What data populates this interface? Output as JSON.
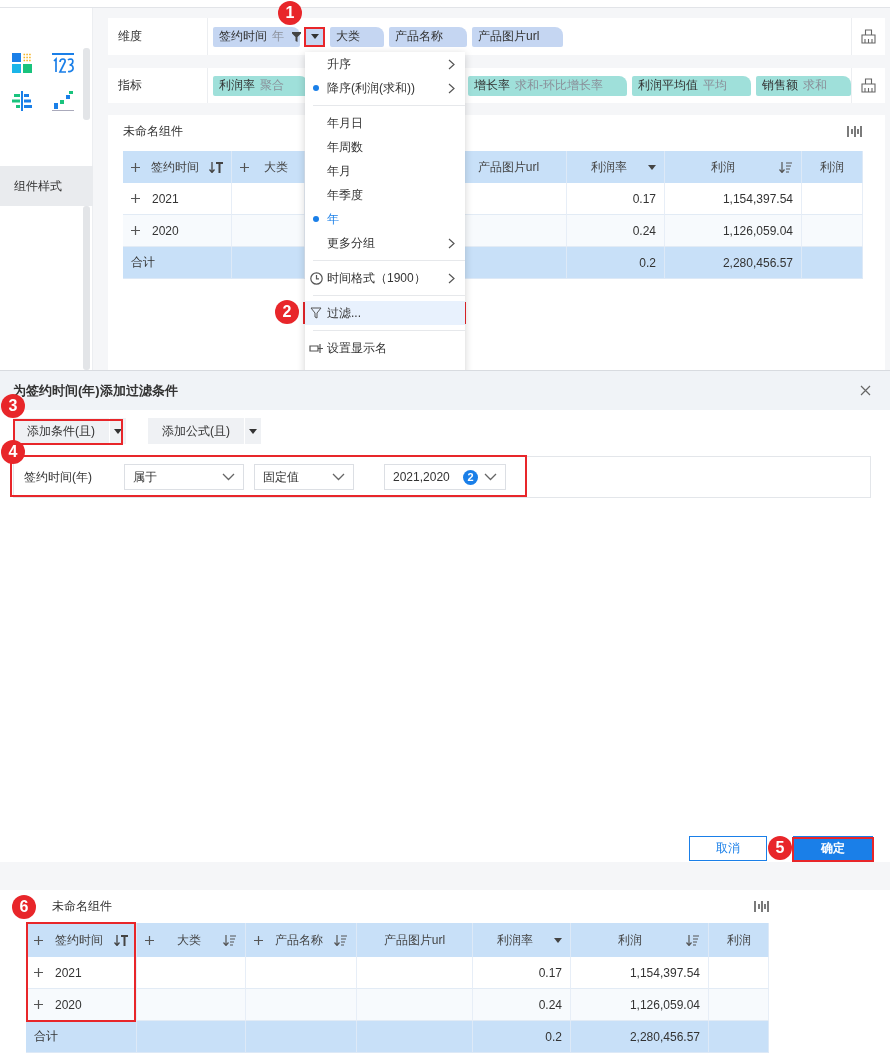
{
  "left_panel": {
    "tab": {
      "label": "组件样式",
      "selected": true
    }
  },
  "dimension_bar": {
    "label": "维度",
    "fields": [
      {
        "name": "签约时间",
        "sub": "年",
        "filtered": true
      },
      {
        "name": "大类",
        "filtered": false
      },
      {
        "name": "产品名称",
        "filtered": false
      },
      {
        "name": "产品图片url",
        "filtered": false
      }
    ]
  },
  "metric_bar": {
    "label": "指标",
    "fields": [
      {
        "name": "利润率",
        "sub": "聚合"
      },
      {
        "name": "增长率",
        "sub": "求和-环比增长率"
      },
      {
        "name": "利润平均值",
        "sub": "平均"
      },
      {
        "name": "销售额",
        "sub": "求和"
      }
    ]
  },
  "dropdown_menu": {
    "items": [
      {
        "kind": "option",
        "label": "升序",
        "selected": false,
        "submenu": true
      },
      {
        "kind": "option",
        "label": "降序(利润(求和))",
        "selected": true,
        "submenu": true
      },
      {
        "kind": "divider"
      },
      {
        "kind": "option",
        "label": "年月日",
        "selected": false,
        "submenu": false
      },
      {
        "kind": "option",
        "label": "年周数",
        "selected": false,
        "submenu": false
      },
      {
        "kind": "option",
        "label": "年月",
        "selected": false,
        "submenu": false
      },
      {
        "kind": "option",
        "label": "年季度",
        "selected": false,
        "submenu": false
      },
      {
        "kind": "option",
        "label": "年",
        "selected": true,
        "submenu": false
      },
      {
        "kind": "option",
        "label": "更多分组",
        "selected": false,
        "submenu": true
      },
      {
        "kind": "divider"
      },
      {
        "kind": "clock",
        "label": "时间格式（1900）",
        "submenu": true
      },
      {
        "kind": "divider"
      },
      {
        "kind": "filter",
        "label": "过滤...",
        "submenu": false,
        "highlighted": true
      },
      {
        "kind": "divider"
      },
      {
        "kind": "rename",
        "label": "设置显示名",
        "submenu": false,
        "highlighted": false
      }
    ]
  },
  "widget": {
    "title": "未命名组件",
    "table": {
      "columns": [
        {
          "label": "签约时间",
          "plus": true,
          "kind": "key"
        },
        {
          "label": "大类",
          "plus": true,
          "kind": "dim"
        },
        {
          "label": "产品图片url",
          "plus": false,
          "kind": "dim"
        },
        {
          "label": "利润率",
          "plus": false,
          "kind": "rate"
        },
        {
          "label": "利润",
          "plus": false,
          "kind": "profit"
        },
        {
          "label": "利润",
          "plus": false,
          "kind": "dim"
        }
      ],
      "rows": [
        {
          "key": "2021",
          "rate": "0.17",
          "profit": "1,154,397.54",
          "expandable": true
        },
        {
          "key": "2020",
          "rate": "0.24",
          "profit": "1,126,059.04",
          "expandable": true
        }
      ],
      "total": {
        "key": "合计",
        "rate": "0.2",
        "profit": "2,280,456.57"
      }
    }
  },
  "dialog": {
    "title": "为签约时间(年)添加过滤条件",
    "add_buttons": [
      "添加条件(且)",
      "添加公式(且)"
    ],
    "condition": {
      "field": "签约时间(年)",
      "operator": "属于",
      "mode": "固定值",
      "value": "2021,2020",
      "count": "2"
    },
    "buttons": [
      {
        "label": "取消",
        "kind": "secondary"
      },
      {
        "label": "确定",
        "kind": "primary"
      }
    ]
  },
  "result_widget": {
    "title": "未命名组件",
    "table": {
      "columns": [
        {
          "label": "签约时间",
          "plus": true,
          "kind": "key"
        },
        {
          "label": "大类",
          "plus": true,
          "kind": "sorted-dim"
        },
        {
          "label": "产品名称",
          "plus": true,
          "kind": "sorted-dim"
        },
        {
          "label": "产品图片url",
          "plus": false,
          "kind": "dim"
        },
        {
          "label": "利润率",
          "plus": false,
          "kind": "rate"
        },
        {
          "label": "利润",
          "plus": false,
          "kind": "profit"
        },
        {
          "label": "利润",
          "plus": false,
          "kind": "dim"
        }
      ],
      "rows": [
        {
          "key": "2021",
          "rate": "0.17",
          "profit": "1,154,397.54",
          "expandable": true
        },
        {
          "key": "2020",
          "rate": "0.24",
          "profit": "1,126,059.04",
          "expandable": true
        }
      ],
      "total": {
        "key": "合计",
        "rate": "0.2",
        "profit": "2,280,456.57"
      }
    }
  },
  "callouts": [
    {
      "label": "1"
    },
    {
      "label": "2"
    },
    {
      "label": "3"
    },
    {
      "label": "4"
    },
    {
      "label": "5"
    },
    {
      "label": "6"
    }
  ]
}
